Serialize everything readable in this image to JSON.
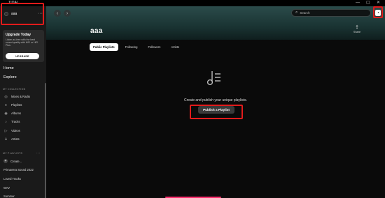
{
  "app": {
    "title": "TIDAL"
  },
  "window_controls": {
    "minimize": "—",
    "maximize": "▢",
    "close": "✕"
  },
  "sidebar": {
    "profile": {
      "name": "aaa",
      "more": "···"
    },
    "upgrade": {
      "title": "Upgrade Today",
      "text": "Listen ad-free with the best sound quality with HiFi or HiFi Plus.",
      "button": "UPGRADE"
    },
    "nav": [
      {
        "label": "Home"
      },
      {
        "label": "Explore"
      }
    ],
    "collection_label": "MY COLLECTION",
    "collection": [
      {
        "label": "Mixes & Radio",
        "icon": "radio-icon"
      },
      {
        "label": "Playlists",
        "icon": "playlist-icon"
      },
      {
        "label": "Albums",
        "icon": "album-icon"
      },
      {
        "label": "Tracks",
        "icon": "track-icon"
      },
      {
        "label": "Videos",
        "icon": "video-icon"
      },
      {
        "label": "Artists",
        "icon": "artist-icon"
      }
    ],
    "playlists_label": "MY PLAYLISTS",
    "playlists_more": "···",
    "create_label": "Create...",
    "playlists": [
      {
        "label": "Primavera Sound 2022"
      },
      {
        "label": "Loved Tracks"
      },
      {
        "label": "WAV"
      },
      {
        "label": "Summer"
      }
    ]
  },
  "header": {
    "back": "‹",
    "forward": "›",
    "search_placeholder": "Search",
    "title": "aaa",
    "share_label": "Share"
  },
  "tabs": [
    {
      "label": "Public Playlists",
      "active": true
    },
    {
      "label": "Following",
      "active": false
    },
    {
      "label": "Followers",
      "active": false
    },
    {
      "label": "Artists",
      "active": false
    }
  ],
  "empty_state": {
    "text": "Create and publish your unique playlists.",
    "button": "Publish a Playlist"
  },
  "colors": {
    "highlight": "#e21b1b",
    "hero_gradient_top": "#2b4b4a",
    "accent_bar": "#ff2c6e"
  }
}
